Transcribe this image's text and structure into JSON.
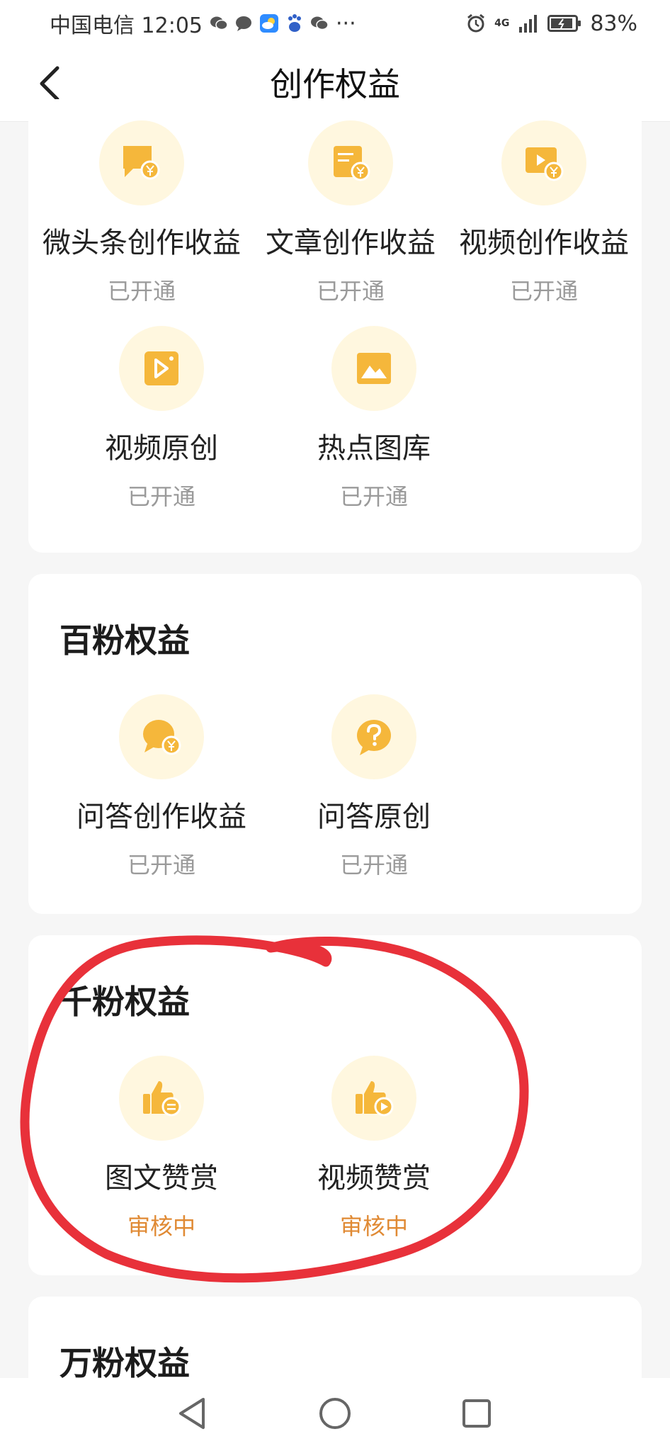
{
  "status_bar": {
    "carrier_time": "中国电信 12:05",
    "more": "···",
    "network": "4G",
    "battery": "83%"
  },
  "nav": {
    "title": "创作权益",
    "back_icon": "chevron-left-icon"
  },
  "section_top": {
    "items": [
      {
        "label": "微头条创作收益",
        "status": "已开通",
        "icon": "comment-yuan-icon"
      },
      {
        "label": "文章创作收益",
        "status": "已开通",
        "icon": "article-yuan-icon"
      },
      {
        "label": "视频创作收益",
        "status": "已开通",
        "icon": "video-yuan-icon"
      },
      {
        "label": "视频原创",
        "status": "已开通",
        "icon": "video-original-icon"
      },
      {
        "label": "热点图库",
        "status": "已开通",
        "icon": "image-gallery-icon"
      }
    ]
  },
  "section_hundred": {
    "title": "百粉权益",
    "items": [
      {
        "label": "问答创作收益",
        "status": "已开通",
        "icon": "qa-yuan-icon"
      },
      {
        "label": "问答原创",
        "status": "已开通",
        "icon": "question-icon"
      }
    ]
  },
  "section_thousand": {
    "title": "千粉权益",
    "items": [
      {
        "label": "图文赞赏",
        "status": "审核中",
        "icon": "thumbs-up-text-icon"
      },
      {
        "label": "视频赞赏",
        "status": "审核中",
        "icon": "thumbs-up-video-icon"
      }
    ]
  },
  "section_tenk": {
    "title": "万粉权益"
  },
  "colors": {
    "icon_gold": "#f5b73b",
    "icon_bg": "#fff7df",
    "status_active": "#9a9a9a",
    "status_pending": "#e08a34",
    "annotation_red": "#e8313a"
  }
}
